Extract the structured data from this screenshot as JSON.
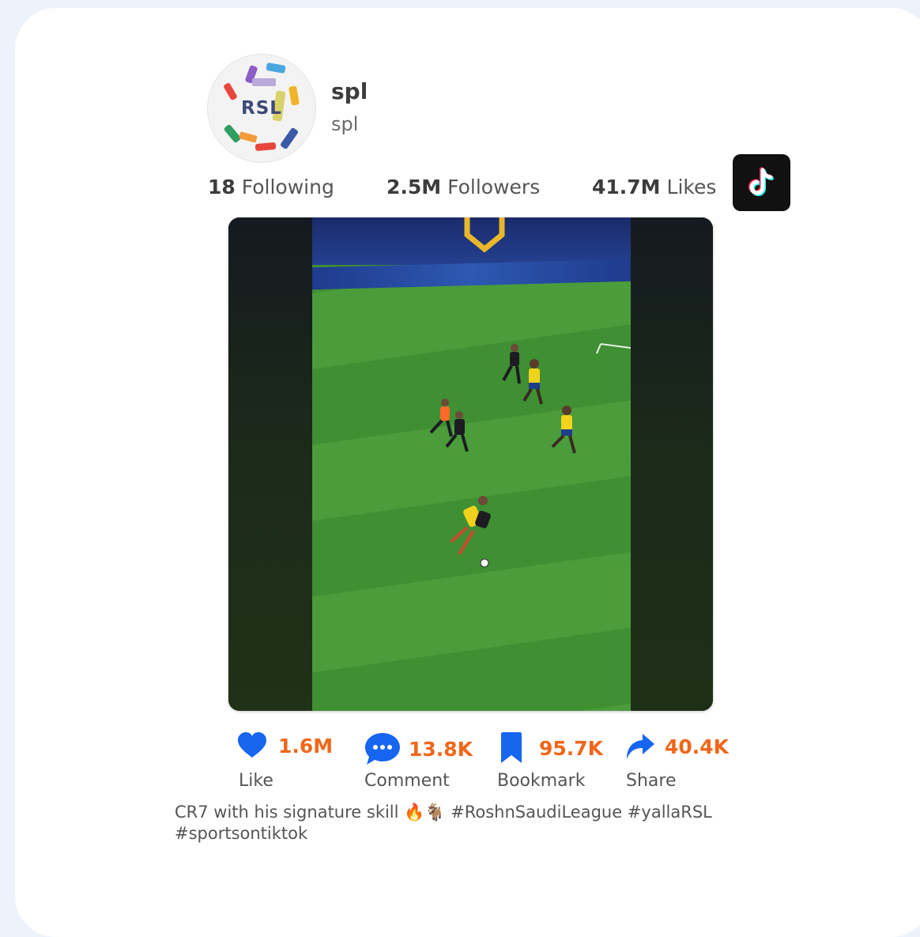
{
  "profile": {
    "avatar_text": "RSL",
    "name": "spl",
    "handle": "spl"
  },
  "stats": {
    "following_value": "18",
    "following_label": "Following",
    "followers_value": "2.5M",
    "followers_label": "Followers",
    "likes_value": "41.7M",
    "likes_label": "Likes"
  },
  "actions": {
    "like_count": "1.6M",
    "like_label": "Like",
    "comment_count": "13.8K",
    "comment_label": "Comment",
    "bookmark_count": "95.7K",
    "bookmark_label": "Bookmark",
    "share_count": "40.4K",
    "share_label": "Share"
  },
  "caption": "CR7 with his signature skill 🔥🐐 #RoshnSaudiLeague #yallaRSL #sportsontiktok",
  "icons": {
    "platform": "tiktok-logo-icon",
    "like": "heart-icon",
    "comment": "speech-bubble-icon",
    "bookmark": "bookmark-icon",
    "share": "share-arrow-icon"
  },
  "colors": {
    "accent_count": "#f0661a",
    "icon_blue": "#1766f0"
  }
}
